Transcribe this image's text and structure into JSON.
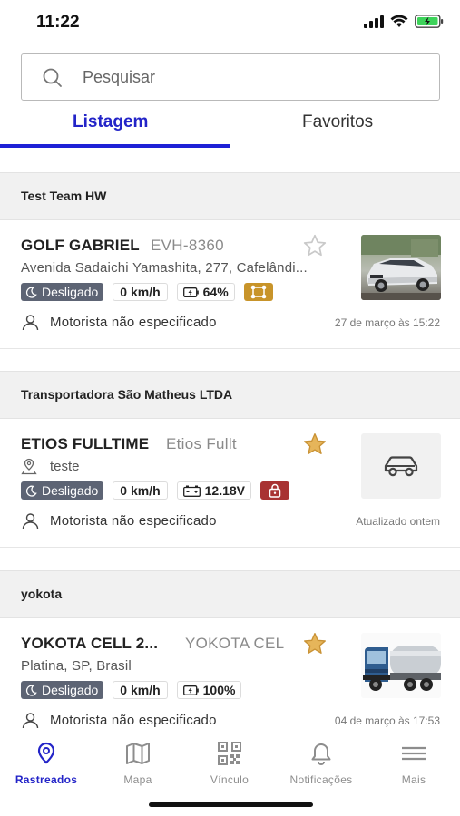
{
  "status_bar": {
    "time": "11:22"
  },
  "search": {
    "placeholder": "Pesquisar"
  },
  "tabs": [
    {
      "label": "Listagem",
      "active": true
    },
    {
      "label": "Favoritos",
      "active": false
    }
  ],
  "groups": [
    {
      "name": "Test Team HW",
      "vehicle": {
        "name": "GOLF GABRIEL",
        "plate": "EVH-8360",
        "favorite": false,
        "address": "Avenida Sadaichi Yamashita, 277, Cafelândi...",
        "status": "Desligado",
        "speed": "0 km/h",
        "power": "64%",
        "power_icon": "battery-icon",
        "badge_icon": "geofence-icon",
        "badge_color": "#c8942a",
        "driver": "Motorista não especificado",
        "updated": "27 de março às 15:22",
        "thumb": "car-photo"
      }
    },
    {
      "name": "Transportadora São Matheus LTDA",
      "vehicle": {
        "name": "ETIOS FULLTIME",
        "plate": "Etios Fullt",
        "favorite": true,
        "address": "teste",
        "status": "Desligado",
        "speed": "0 km/h",
        "power": "12.18V",
        "power_icon": "car-battery-icon",
        "badge_icon": "lock-icon",
        "badge_color": "#a83232",
        "driver": "Motorista não especificado",
        "updated": "Atualizado ontem",
        "thumb": "car-icon"
      }
    },
    {
      "name": "yokota",
      "vehicle": {
        "name": "YOKOTA CELL 2...",
        "plate": "YOKOTA CEL",
        "favorite": true,
        "address": "Platina, SP, Brasil",
        "status": "Desligado",
        "speed": "0 km/h",
        "power": "100%",
        "power_icon": "battery-icon",
        "driver": "Motorista não especificado",
        "updated": "04 de março às 17:53",
        "thumb": "truck-photo"
      }
    }
  ],
  "bottom_nav": [
    {
      "label": "Rastreados",
      "icon": "location-pin-icon",
      "active": true
    },
    {
      "label": "Mapa",
      "icon": "map-icon",
      "active": false
    },
    {
      "label": "Vínculo",
      "icon": "qr-code-icon",
      "active": false
    },
    {
      "label": "Notificações",
      "icon": "bell-icon",
      "active": false
    },
    {
      "label": "Mais",
      "icon": "menu-icon",
      "active": false
    }
  ],
  "colors": {
    "accent": "#2324c8",
    "status_chip": "#5d6474",
    "favorite_star": "#e6b55a"
  }
}
